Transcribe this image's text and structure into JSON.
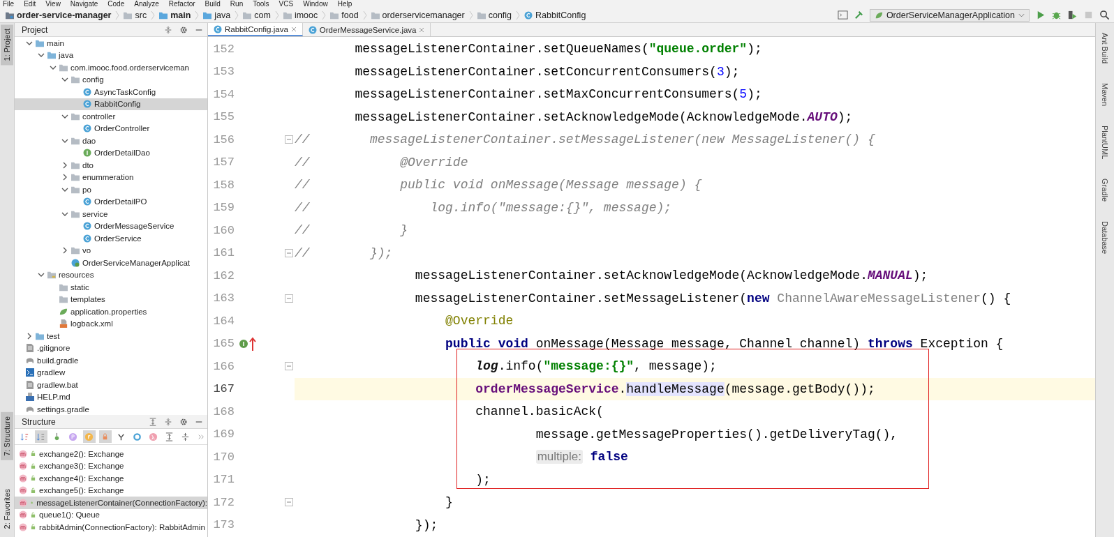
{
  "menu": [
    "File",
    "Edit",
    "View",
    "Navigate",
    "Code",
    "Analyze",
    "Refactor",
    "Build",
    "Run",
    "Tools",
    "VCS",
    "Window",
    "Help"
  ],
  "breadcrumbs": [
    {
      "label": "order-service-manager",
      "kind": "module",
      "bold": true
    },
    {
      "label": "src",
      "kind": "folder",
      "bold": false
    },
    {
      "label": "main",
      "kind": "source",
      "bold": true
    },
    {
      "label": "java",
      "kind": "source",
      "bold": false
    },
    {
      "label": "com",
      "kind": "package",
      "bold": false
    },
    {
      "label": "imooc",
      "kind": "package",
      "bold": false
    },
    {
      "label": "food",
      "kind": "package",
      "bold": false
    },
    {
      "label": "orderservicemanager",
      "kind": "package",
      "bold": false
    },
    {
      "label": "config",
      "kind": "package",
      "bold": false
    },
    {
      "label": "RabbitConfig",
      "kind": "class",
      "bold": false
    }
  ],
  "run_config": {
    "label": "OrderServiceManagerApplication"
  },
  "left_stripe": [
    {
      "label": "1: Project",
      "selected": true
    },
    {
      "label": "7: Structure",
      "selected": true
    },
    {
      "label": "2: Favorites",
      "selected": false
    }
  ],
  "right_stripe": [
    "Ant Build",
    "Maven",
    "PlantUML",
    "Gradle",
    "Database"
  ],
  "project_panel": {
    "title": "Project"
  },
  "project_tree": [
    {
      "label": "main",
      "kind": "source",
      "expanded": true,
      "selected": false,
      "children": [
        {
          "label": "java",
          "kind": "source",
          "expanded": true,
          "selected": false,
          "children": [
            {
              "label": "com.imooc.food.orderserviceman",
              "kind": "package",
              "expanded": true,
              "selected": false,
              "children": [
                {
                  "label": "config",
                  "kind": "package",
                  "expanded": true,
                  "selected": false,
                  "children": [
                    {
                      "label": "AsyncTaskConfig",
                      "kind": "class",
                      "selected": false
                    },
                    {
                      "label": "RabbitConfig",
                      "kind": "class",
                      "selected": true
                    }
                  ]
                },
                {
                  "label": "controller",
                  "kind": "package",
                  "expanded": true,
                  "selected": false,
                  "children": [
                    {
                      "label": "OrderController",
                      "kind": "class",
                      "selected": false
                    }
                  ]
                },
                {
                  "label": "dao",
                  "kind": "package",
                  "expanded": true,
                  "selected": false,
                  "children": [
                    {
                      "label": "OrderDetailDao",
                      "kind": "interface",
                      "selected": false
                    }
                  ]
                },
                {
                  "label": "dto",
                  "kind": "package",
                  "expanded": false,
                  "selected": false
                },
                {
                  "label": "enummeration",
                  "kind": "package",
                  "expanded": false,
                  "selected": false
                },
                {
                  "label": "po",
                  "kind": "package",
                  "expanded": true,
                  "selected": false,
                  "children": [
                    {
                      "label": "OrderDetailPO",
                      "kind": "class",
                      "selected": false
                    }
                  ]
                },
                {
                  "label": "service",
                  "kind": "package",
                  "expanded": true,
                  "selected": false,
                  "children": [
                    {
                      "label": "OrderMessageService",
                      "kind": "class",
                      "selected": false
                    },
                    {
                      "label": "OrderService",
                      "kind": "class",
                      "selected": false
                    }
                  ]
                },
                {
                  "label": "vo",
                  "kind": "package",
                  "expanded": false,
                  "selected": false
                },
                {
                  "label": "OrderServiceManagerApplicat",
                  "kind": "app",
                  "selected": false
                }
              ]
            }
          ]
        },
        {
          "label": "resources",
          "kind": "resources",
          "expanded": true,
          "selected": false,
          "children": [
            {
              "label": "static",
              "kind": "package",
              "selected": false
            },
            {
              "label": "templates",
              "kind": "package",
              "selected": false
            },
            {
              "label": "application.properties",
              "kind": "properties",
              "selected": false
            },
            {
              "label": "logback.xml",
              "kind": "xml",
              "selected": false
            }
          ]
        }
      ]
    },
    {
      "label": "test",
      "kind": "source",
      "expanded": false,
      "selected": false
    },
    {
      "label": ".gitignore",
      "kind": "file",
      "selected": false
    },
    {
      "label": "build.gradle",
      "kind": "gradle",
      "selected": false
    },
    {
      "label": "gradlew",
      "kind": "terminal",
      "selected": false
    },
    {
      "label": "gradlew.bat",
      "kind": "file",
      "selected": false
    },
    {
      "label": "HELP.md",
      "kind": "md",
      "selected": false
    },
    {
      "label": "settings.gradle",
      "kind": "gradle",
      "selected": false
    }
  ],
  "structure_panel": {
    "title": "Structure"
  },
  "structure_toolbar": [
    {
      "kind": "sort-visibility",
      "on": false
    },
    {
      "kind": "sort-alpha",
      "on": true
    },
    {
      "kind": "inherited",
      "on": false
    },
    {
      "kind": "properties",
      "on": false
    },
    {
      "kind": "fields",
      "on": true
    },
    {
      "kind": "non-public",
      "on": true
    },
    {
      "kind": "hierarchy",
      "on": false
    },
    {
      "kind": "anonymous",
      "on": false
    },
    {
      "kind": "lambda",
      "on": false
    },
    {
      "kind": "expand",
      "on": false
    },
    {
      "kind": "collapse",
      "on": false
    },
    {
      "kind": "more",
      "on": false
    }
  ],
  "structure_items": [
    {
      "label": "exchange2(): Exchange",
      "selected": false
    },
    {
      "label": "exchange3(): Exchange",
      "selected": false
    },
    {
      "label": "exchange4(): Exchange",
      "selected": false
    },
    {
      "label": "exchange5(): Exchange",
      "selected": false
    },
    {
      "label": "messageListenerContainer(ConnectionFactory):",
      "selected": true
    },
    {
      "label": "queue1(): Queue",
      "selected": false
    },
    {
      "label": "rabbitAdmin(ConnectionFactory): RabbitAdmin",
      "selected": false
    }
  ],
  "editor_tabs": [
    {
      "label": "RabbitConfig.java",
      "selected": true
    },
    {
      "label": "OrderMessageService.java",
      "selected": false
    }
  ],
  "code_lines": [
    {
      "number": "152",
      "fold": false,
      "implements": false,
      "current": false,
      "boxed": false,
      "segments": [
        {
          "kind": "plain",
          "text": "        messageListenerContainer.setQueueNames("
        },
        {
          "kind": "string",
          "text": "\"queue.order\""
        },
        {
          "kind": "plain",
          "text": ");"
        }
      ]
    },
    {
      "number": "153",
      "fold": false,
      "implements": false,
      "current": false,
      "boxed": false,
      "segments": [
        {
          "kind": "plain",
          "text": "        messageListenerContainer.setConcurrentConsumers("
        },
        {
          "kind": "number",
          "text": "3"
        },
        {
          "kind": "plain",
          "text": ");"
        }
      ]
    },
    {
      "number": "154",
      "fold": false,
      "implements": false,
      "current": false,
      "boxed": false,
      "segments": [
        {
          "kind": "plain",
          "text": "        messageListenerContainer.setMaxConcurrentConsumers("
        },
        {
          "kind": "number",
          "text": "5"
        },
        {
          "kind": "plain",
          "text": ");"
        }
      ]
    },
    {
      "number": "155",
      "fold": false,
      "implements": false,
      "current": false,
      "boxed": false,
      "segments": [
        {
          "kind": "plain",
          "text": "        messageListenerContainer.setAcknowledgeMode(AcknowledgeMode."
        },
        {
          "kind": "constant",
          "text": "AUTO"
        },
        {
          "kind": "plain",
          "text": ");"
        }
      ]
    },
    {
      "number": "156",
      "fold": true,
      "implements": false,
      "current": false,
      "boxed": false,
      "segments": [
        {
          "kind": "comment",
          "text": "//        messageListenerContainer.setMessageListener(new MessageListener() {"
        }
      ]
    },
    {
      "number": "157",
      "fold": false,
      "implements": false,
      "current": false,
      "boxed": false,
      "segments": [
        {
          "kind": "comment",
          "text": "//            @Override"
        }
      ]
    },
    {
      "number": "158",
      "fold": false,
      "implements": false,
      "current": false,
      "boxed": false,
      "segments": [
        {
          "kind": "comment",
          "text": "//            public void onMessage(Message message) {"
        }
      ]
    },
    {
      "number": "159",
      "fold": false,
      "implements": false,
      "current": false,
      "boxed": false,
      "segments": [
        {
          "kind": "comment",
          "text": "//                log.info(\"message:{}\", message);"
        }
      ]
    },
    {
      "number": "160",
      "fold": false,
      "implements": false,
      "current": false,
      "boxed": false,
      "segments": [
        {
          "kind": "comment",
          "text": "//            }"
        }
      ]
    },
    {
      "number": "161",
      "fold": true,
      "implements": false,
      "current": false,
      "boxed": false,
      "segments": [
        {
          "kind": "comment",
          "text": "//        });"
        }
      ]
    },
    {
      "number": "162",
      "fold": false,
      "implements": false,
      "current": false,
      "boxed": false,
      "segments": [
        {
          "kind": "plain",
          "text": "                messageListenerContainer.setAcknowledgeMode(AcknowledgeMode."
        },
        {
          "kind": "constant",
          "text": "MANUAL"
        },
        {
          "kind": "plain",
          "text": ");"
        }
      ]
    },
    {
      "number": "163",
      "fold": true,
      "implements": false,
      "current": false,
      "boxed": false,
      "segments": [
        {
          "kind": "plain",
          "text": "                messageListenerContainer.setMessageListener("
        },
        {
          "kind": "keyword",
          "text": "new "
        },
        {
          "kind": "grey",
          "text": "ChannelAwareMessageListener"
        },
        {
          "kind": "plain",
          "text": "() {"
        }
      ]
    },
    {
      "number": "164",
      "fold": false,
      "implements": false,
      "current": false,
      "boxed": false,
      "segments": [
        {
          "kind": "annotation",
          "text": "                    @Override"
        }
      ]
    },
    {
      "number": "165",
      "fold": false,
      "implements": true,
      "current": false,
      "boxed": false,
      "segments": [
        {
          "kind": "keyword",
          "text": "                    public void "
        },
        {
          "kind": "plain",
          "text": "onMessage(Message message, Channel channel) "
        },
        {
          "kind": "keyword",
          "text": "throws "
        },
        {
          "kind": "plain",
          "text": "Exception {"
        }
      ]
    },
    {
      "number": "166",
      "fold": true,
      "implements": false,
      "current": false,
      "boxed": true,
      "segments": [
        {
          "kind": "static",
          "text": "                        log"
        },
        {
          "kind": "plain",
          "text": ".info("
        },
        {
          "kind": "string",
          "text": "\"message:{}\""
        },
        {
          "kind": "plain",
          "text": ", message);"
        }
      ]
    },
    {
      "number": "167",
      "fold": false,
      "implements": false,
      "current": true,
      "boxed": true,
      "segments": [
        {
          "kind": "member",
          "text": "                        orderMessageService"
        },
        {
          "kind": "plain",
          "text": "."
        },
        {
          "kind": "usage",
          "text": "handleMessage"
        },
        {
          "kind": "plain",
          "text": "(message.getBody());"
        }
      ]
    },
    {
      "number": "168",
      "fold": false,
      "implements": false,
      "current": false,
      "boxed": true,
      "segments": [
        {
          "kind": "plain",
          "text": "                        channel.basicAck("
        }
      ]
    },
    {
      "number": "169",
      "fold": false,
      "implements": false,
      "current": false,
      "boxed": true,
      "segments": [
        {
          "kind": "plain",
          "text": "                                message.getMessageProperties().getDeliveryTag(),"
        }
      ]
    },
    {
      "number": "170",
      "fold": false,
      "implements": false,
      "current": false,
      "boxed": true,
      "segments": [
        {
          "kind": "hint",
          "text": "                                multiple:"
        },
        {
          "kind": "keyword",
          "text": " false"
        }
      ]
    },
    {
      "number": "171",
      "fold": false,
      "implements": false,
      "current": false,
      "boxed": true,
      "segments": [
        {
          "kind": "plain",
          "text": "                        );"
        }
      ]
    },
    {
      "number": "172",
      "fold": true,
      "implements": false,
      "current": false,
      "boxed": false,
      "segments": [
        {
          "kind": "plain",
          "text": "                    }"
        }
      ]
    },
    {
      "number": "173",
      "fold": false,
      "implements": false,
      "current": false,
      "boxed": false,
      "segments": [
        {
          "kind": "plain",
          "text": "                });"
        }
      ]
    }
  ]
}
